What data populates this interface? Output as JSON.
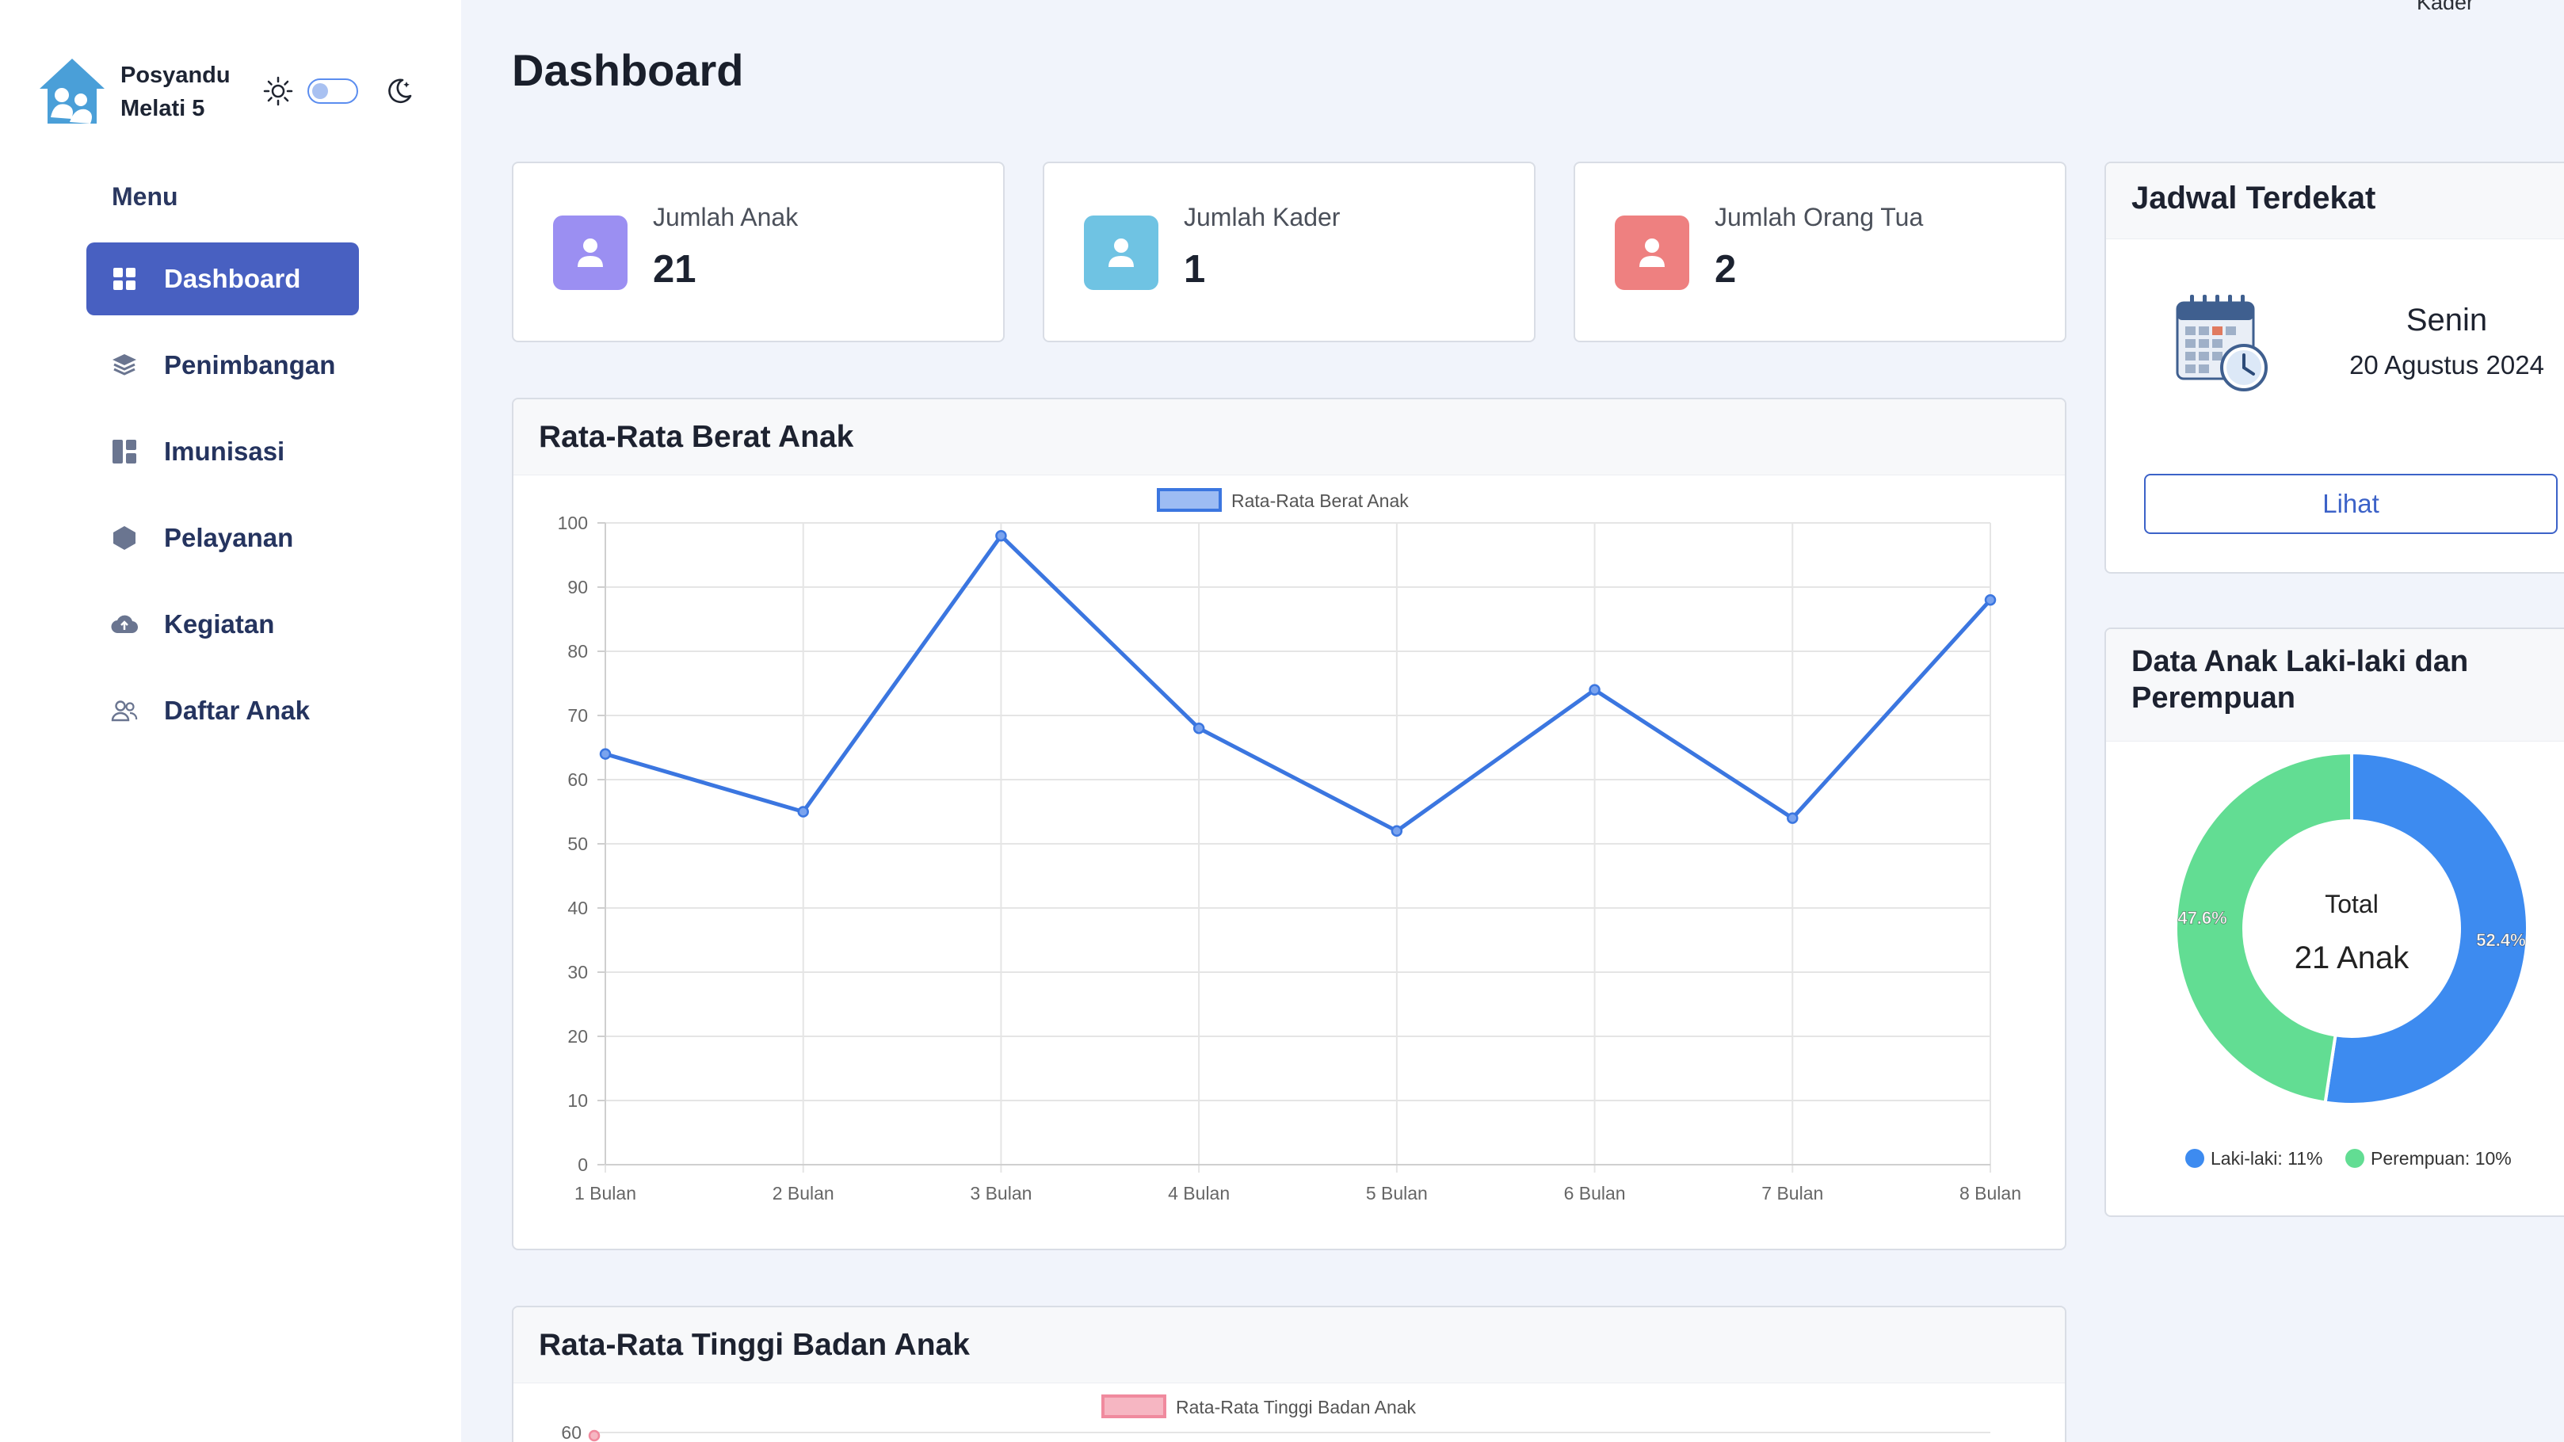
{
  "brand": {
    "line1": "Posyandu",
    "line2": "Melati 5"
  },
  "top_user": "Kader",
  "menu_title": "Menu",
  "nav": [
    {
      "label": "Dashboard",
      "icon": "grid-icon",
      "active": true
    },
    {
      "label": "Penimbangan",
      "icon": "layers-icon",
      "active": false
    },
    {
      "label": "Imunisasi",
      "icon": "layout-icon",
      "active": false
    },
    {
      "label": "Pelayanan",
      "icon": "hexagon-icon",
      "active": false
    },
    {
      "label": "Kegiatan",
      "icon": "cloud-upload-icon",
      "active": false
    },
    {
      "label": "Daftar Anak",
      "icon": "users-icon",
      "active": false
    }
  ],
  "page_title": "Dashboard",
  "stats": [
    {
      "label": "Jumlah Anak",
      "value": "21",
      "color": "#9b8ff2"
    },
    {
      "label": "Jumlah Kader",
      "value": "1",
      "color": "#6fc3e3"
    },
    {
      "label": "Jumlah Orang Tua",
      "value": "2",
      "color": "#ee8080"
    }
  ],
  "jadwal": {
    "title": "Jadwal Terdekat",
    "day": "Senin",
    "date": "20 Agustus 2024",
    "button": "Lihat"
  },
  "gender": {
    "title_line1": "Data Anak Laki-laki dan",
    "title_line2": "Perempuan",
    "center_label": "Total",
    "center_value": "21 Anak"
  },
  "colors": {
    "accent": "#4860c1",
    "line_blue": "#3b76e0",
    "donut_blue": "#3d8bf0",
    "donut_green": "#62dd93",
    "pink": "#f08a9e"
  },
  "chart_data": [
    {
      "type": "line",
      "title": "Rata-Rata Berat Anak",
      "categories": [
        "1 Bulan",
        "2 Bulan",
        "3 Bulan",
        "4 Bulan",
        "5 Bulan",
        "6 Bulan",
        "7 Bulan",
        "8 Bulan"
      ],
      "series": [
        {
          "name": "Rata-Rata Berat Anak",
          "values": [
            64,
            55,
            98,
            68,
            52,
            74,
            54,
            88
          ]
        }
      ],
      "ylim": [
        0,
        100
      ],
      "yticks": [
        0,
        10,
        20,
        30,
        40,
        50,
        60,
        70,
        80,
        90,
        100
      ],
      "grid": true,
      "legend": "top"
    },
    {
      "type": "line",
      "title": "Rata-Rata Tinggi Badan Anak",
      "series": [
        {
          "name": "Rata-Rata Tinggi Badan Anak",
          "values": []
        }
      ],
      "yticks_visible": [
        60
      ],
      "legend": "top"
    },
    {
      "type": "pie",
      "title": "Data Anak Laki-laki dan Perempuan",
      "slices": [
        {
          "label": "Laki-laki: 11%",
          "percent": 52.4,
          "percent_label": "52.4%"
        },
        {
          "label": "Perempuan: 10%",
          "percent": 47.6,
          "percent_label": "47.6%"
        }
      ],
      "legend": "bottom"
    }
  ]
}
